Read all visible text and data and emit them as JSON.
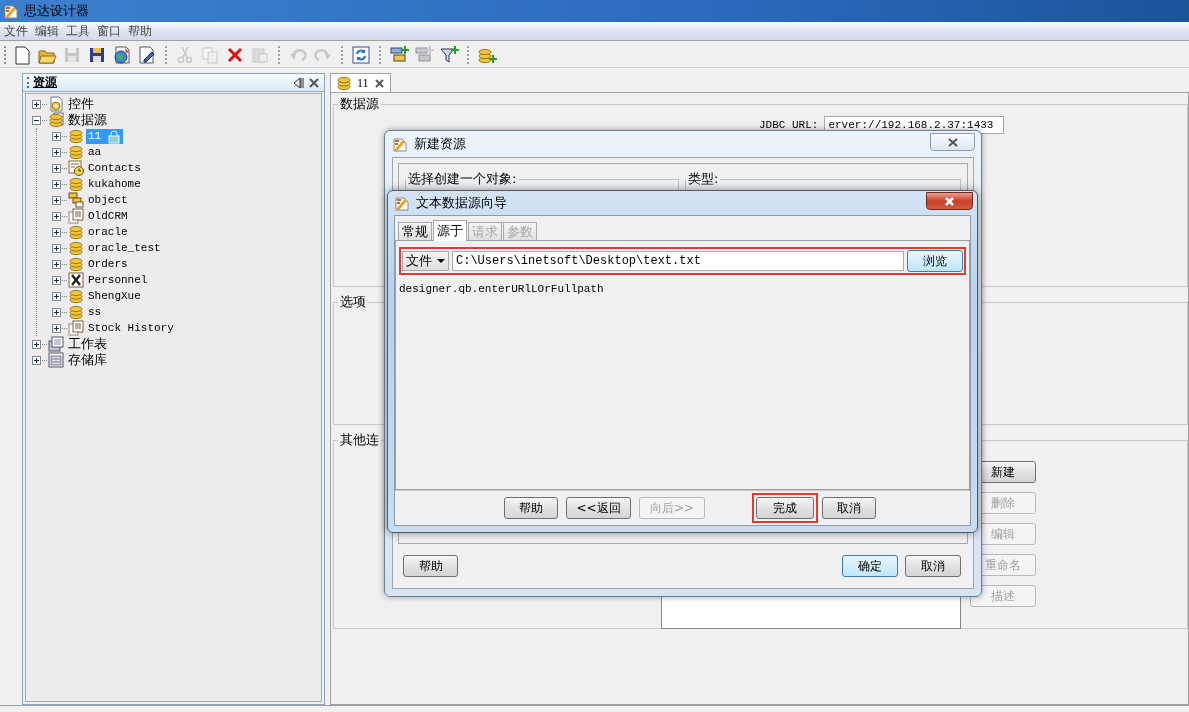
{
  "window": {
    "title": "思达设计器"
  },
  "menu": [
    {
      "label": "文件"
    },
    {
      "label": "编辑"
    },
    {
      "label": "工具"
    },
    {
      "label": "窗口"
    },
    {
      "label": "帮助"
    }
  ],
  "toolbar": [
    {
      "kind": "new",
      "disabled": false
    },
    {
      "kind": "open",
      "disabled": false
    },
    {
      "kind": "save",
      "disabled": true
    },
    {
      "kind": "save-all",
      "disabled": false
    },
    {
      "kind": "globe",
      "disabled": false
    },
    {
      "kind": "edit",
      "disabled": false
    },
    {
      "kind": "separator"
    },
    {
      "kind": "cut",
      "disabled": true
    },
    {
      "kind": "copy",
      "disabled": true
    },
    {
      "kind": "delete",
      "disabled": false
    },
    {
      "kind": "paste",
      "disabled": true
    },
    {
      "kind": "separator"
    },
    {
      "kind": "undo",
      "disabled": true
    },
    {
      "kind": "redo",
      "disabled": true
    },
    {
      "kind": "separator"
    },
    {
      "kind": "refresh",
      "disabled": false
    },
    {
      "kind": "separator"
    },
    {
      "kind": "add-table",
      "disabled": false
    },
    {
      "kind": "add-table",
      "disabled": true
    },
    {
      "kind": "add-filter",
      "disabled": false
    },
    {
      "kind": "separator"
    },
    {
      "kind": "add-database",
      "disabled": false
    }
  ],
  "resource_panel": {
    "title": "资源",
    "tree": [
      {
        "label": "控件",
        "kind": "widgets",
        "expanded": false,
        "selected": false,
        "locked": false
      },
      {
        "label": "数据源",
        "kind": "database-doc",
        "expanded": true,
        "selected": false,
        "locked": false,
        "children": [
          {
            "label": "11",
            "kind": "database",
            "expanded": false,
            "selected": true,
            "locked": true
          },
          {
            "label": "aa",
            "kind": "database",
            "expanded": false,
            "selected": false,
            "locked": false
          },
          {
            "label": "Contacts",
            "kind": "calendar",
            "expanded": false,
            "selected": false,
            "locked": false
          },
          {
            "label": "kukahome",
            "kind": "database",
            "expanded": false,
            "selected": false,
            "locked": false
          },
          {
            "label": "object",
            "kind": "boxes",
            "expanded": false,
            "selected": false,
            "locked": false
          },
          {
            "label": "OldCRM",
            "kind": "pages",
            "expanded": false,
            "selected": false,
            "locked": false
          },
          {
            "label": "oracle",
            "kind": "database",
            "expanded": false,
            "selected": false,
            "locked": false
          },
          {
            "label": "oracle_test",
            "kind": "database",
            "expanded": false,
            "selected": false,
            "locked": false
          },
          {
            "label": "Orders",
            "kind": "database",
            "expanded": false,
            "selected": false,
            "locked": false
          },
          {
            "label": "Personnel",
            "kind": "x-box",
            "expanded": false,
            "selected": false,
            "locked": false
          },
          {
            "label": "ShengXue",
            "kind": "database",
            "expanded": false,
            "selected": false,
            "locked": false
          },
          {
            "label": "ss",
            "kind": "database",
            "expanded": false,
            "selected": false,
            "locked": false
          },
          {
            "label": "Stock History",
            "kind": "pages",
            "expanded": false,
            "selected": false,
            "locked": false
          }
        ]
      },
      {
        "label": "工作表",
        "kind": "worksheet",
        "expanded": false,
        "selected": false,
        "locked": false
      },
      {
        "label": "存储库",
        "kind": "repository",
        "expanded": false,
        "selected": false,
        "locked": false
      }
    ]
  },
  "editor_tab": {
    "label": "11"
  },
  "datasource_group": {
    "title": "数据源",
    "jdbc_label": "JDBC URL:",
    "jdbc_value": "erver://192.168.2.37:1433"
  },
  "options_group": {
    "title": "选项"
  },
  "connections_group": {
    "title": "其他连",
    "buttons": [
      {
        "label": "新建",
        "disabled": false
      },
      {
        "label": "删除",
        "disabled": true
      },
      {
        "label": "编辑",
        "disabled": true
      },
      {
        "label": "重命名",
        "disabled": true
      },
      {
        "label": "描述",
        "disabled": true
      }
    ]
  },
  "new_resource_dialog": {
    "title": "新建资源",
    "object_group": "选择创建一个对象:",
    "type_group": "类型:",
    "buttons": [
      {
        "label": "帮助",
        "default": false
      },
      {
        "label": "确定",
        "default": true
      },
      {
        "label": "取消",
        "default": false
      }
    ]
  },
  "wizard": {
    "title": "文本数据源向导",
    "tabs": [
      {
        "label": "常规",
        "selected": false,
        "disabled": false
      },
      {
        "label": "源于",
        "selected": true,
        "disabled": false
      },
      {
        "label": "请求",
        "selected": false,
        "disabled": true
      },
      {
        "label": "参数",
        "selected": false,
        "disabled": true
      }
    ],
    "source_row_highlighted": true,
    "source_type": "文件",
    "path": "C:\\Users\\inetsoft\\Desktop\\text.txt",
    "browse": "浏览",
    "hint": "designer.qb.enterURlLOrFullpath",
    "buttons": [
      {
        "label": "帮助",
        "disabled": false,
        "highlighted": false
      },
      {
        "label": "<<返回",
        "disabled": false,
        "highlighted": false
      },
      {
        "label": "向后>>",
        "disabled": true,
        "highlighted": false
      },
      {
        "label": "完成",
        "disabled": false,
        "highlighted": true
      },
      {
        "label": "取消",
        "disabled": false,
        "highlighted": false
      }
    ]
  }
}
